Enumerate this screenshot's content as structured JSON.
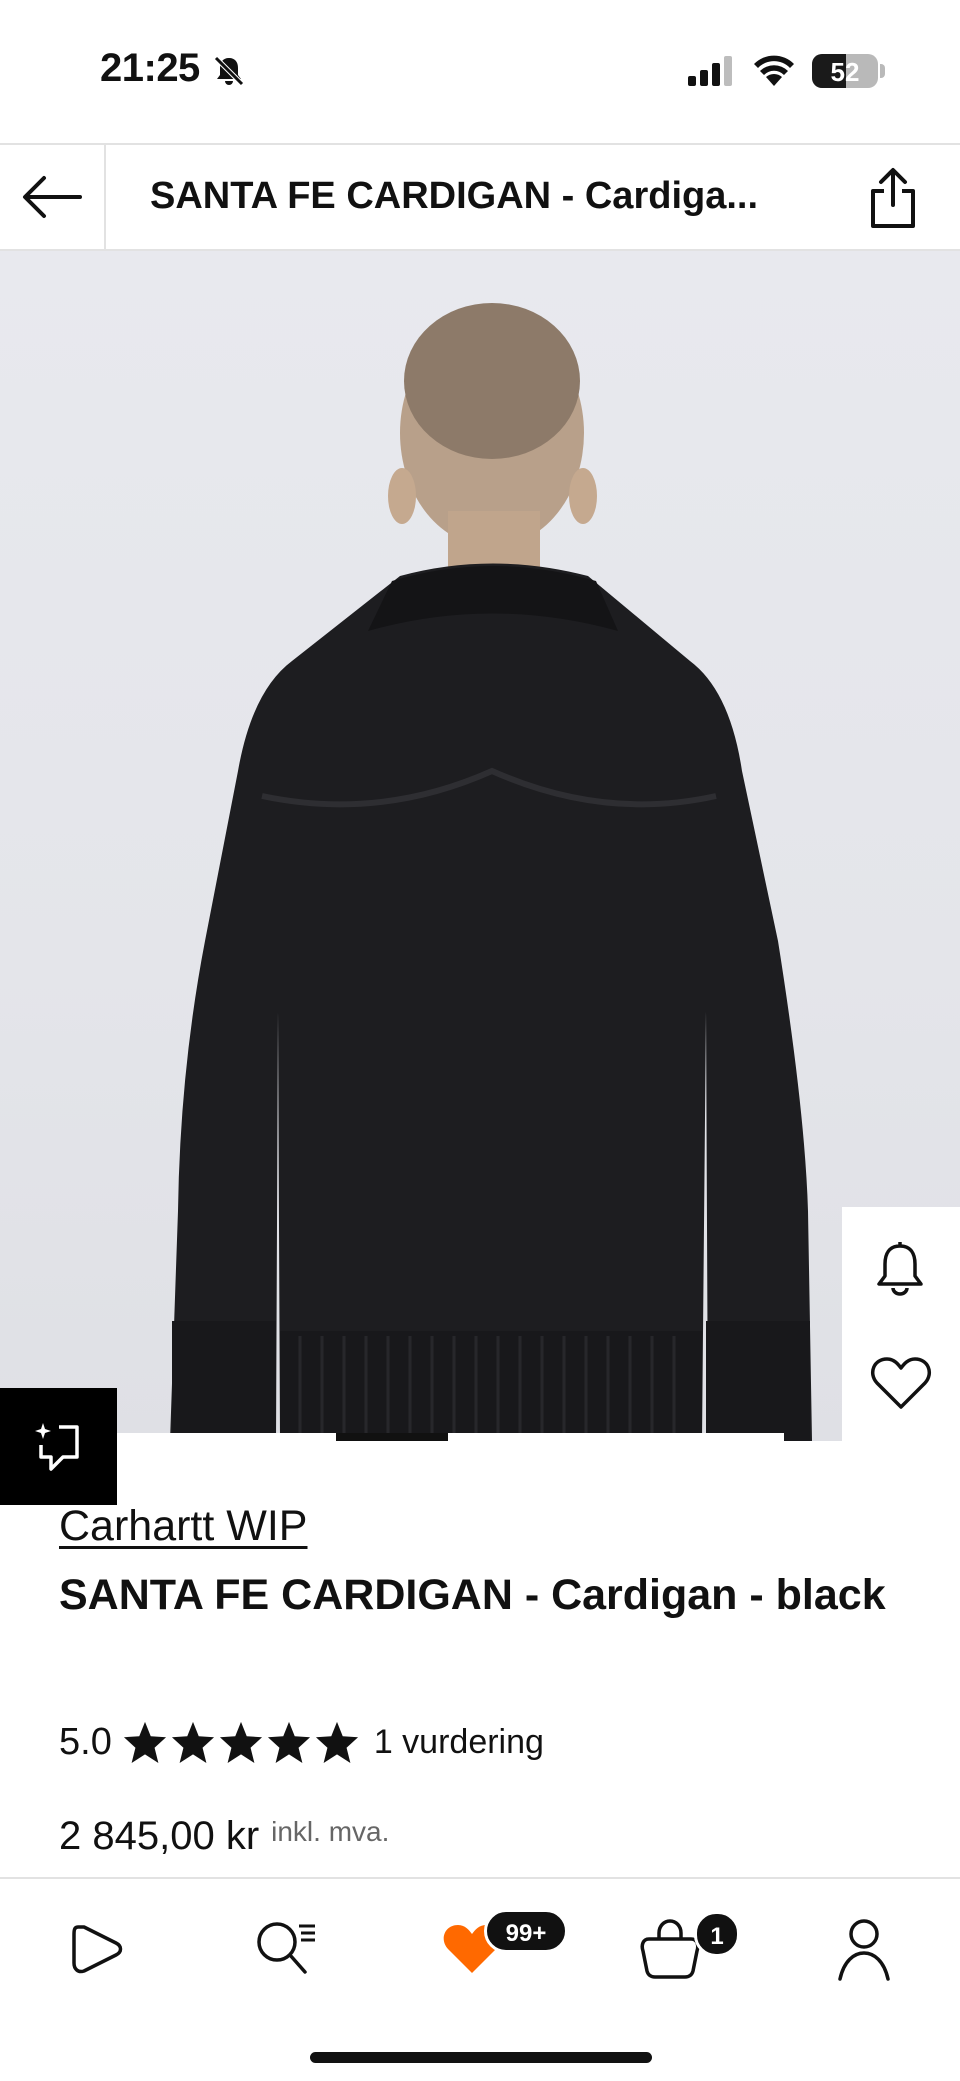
{
  "status_bar": {
    "time": "21:25",
    "battery": "52",
    "battery_level": 0.52
  },
  "header": {
    "title": "SANTA FE CARDIGAN - Cardiga..."
  },
  "gallery": {
    "active_index": 1,
    "image_count": 4
  },
  "product": {
    "brand": "Carhartt WIP",
    "name": "SANTA FE CARDIGAN - Cardigan - black",
    "rating_score": "5.0",
    "stars": 5,
    "rating_count": "1 vurdering",
    "price": "2 845,00 kr",
    "vat_note": "inkl. mva."
  },
  "bottom_nav": {
    "wishlist_badge": "99+",
    "bag_badge": "1"
  },
  "colors": {
    "accent_orange": "#ff6900",
    "text": "#111111",
    "divider": "#e2e2e2"
  },
  "icons": [
    "back-arrow-icon",
    "share-icon",
    "bell-icon",
    "heart-icon",
    "ar-view-icon",
    "star-icon",
    "play-logo-icon",
    "search-icon",
    "wishlist-heart-icon",
    "bag-icon",
    "profile-icon"
  ]
}
